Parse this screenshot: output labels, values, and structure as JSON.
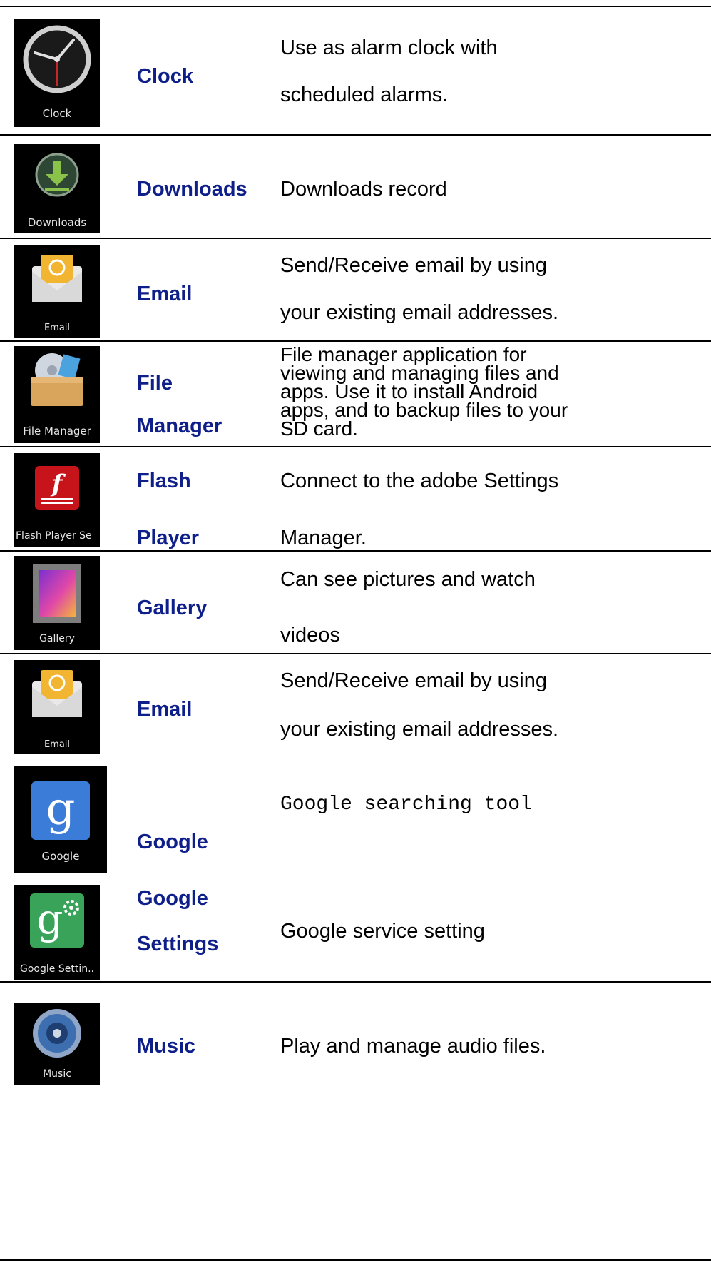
{
  "apps": [
    {
      "icon": "clock-icon",
      "tile_caption": "Clock",
      "name_lines": [
        "Clock"
      ],
      "desc_lines": [
        "Use as alarm clock with",
        "scheduled alarms."
      ]
    },
    {
      "icon": "download-icon",
      "tile_caption": "Downloads",
      "name_lines": [
        "Downloads"
      ],
      "desc_lines": [
        "Downloads record"
      ]
    },
    {
      "icon": "email-icon",
      "tile_caption": "Email",
      "name_lines": [
        "Email"
      ],
      "desc_lines": [
        "Send/Receive email by using",
        "your existing email addresses."
      ]
    },
    {
      "icon": "file-manager-icon",
      "tile_caption": "File Manager",
      "name_lines": [
        "File",
        "Manager"
      ],
      "desc_lines": [
        "File manager application for",
        "viewing and managing files and",
        "apps. Use it to install Android",
        "apps, and to backup files to your",
        "SD card."
      ]
    },
    {
      "icon": "flash-player-icon",
      "tile_caption": "Flash Player Se",
      "name_lines": [
        "Flash",
        "Player"
      ],
      "desc_lines": [
        "Connect to the adobe Settings",
        "Manager."
      ]
    },
    {
      "icon": "gallery-icon",
      "tile_caption": "Gallery",
      "name_lines": [
        "Gallery"
      ],
      "desc_lines": [
        "Can see pictures and watch",
        "videos"
      ]
    },
    {
      "icon": "email-icon",
      "tile_caption": "Email",
      "name_lines": [
        "Email"
      ],
      "desc_lines": [
        "Send/Receive email by using",
        "your existing email addresses."
      ]
    },
    {
      "icon": "google-icon",
      "tile_caption": "Google",
      "name_lines": [
        "Google"
      ],
      "desc_lines": [
        "Google searching tool"
      ]
    },
    {
      "icon": "google-settings-icon",
      "tile_caption": "Google Settin..",
      "name_lines": [
        "Google",
        "Settings"
      ],
      "desc_lines": [
        "Google service setting"
      ]
    },
    {
      "icon": "music-icon",
      "tile_caption": "Music",
      "name_lines": [
        "Music"
      ],
      "desc_lines": [
        "Play and manage audio files."
      ]
    }
  ],
  "colors": {
    "app_name": "#0f1f8a",
    "tile_background": "#000000",
    "rule": "#000000"
  }
}
